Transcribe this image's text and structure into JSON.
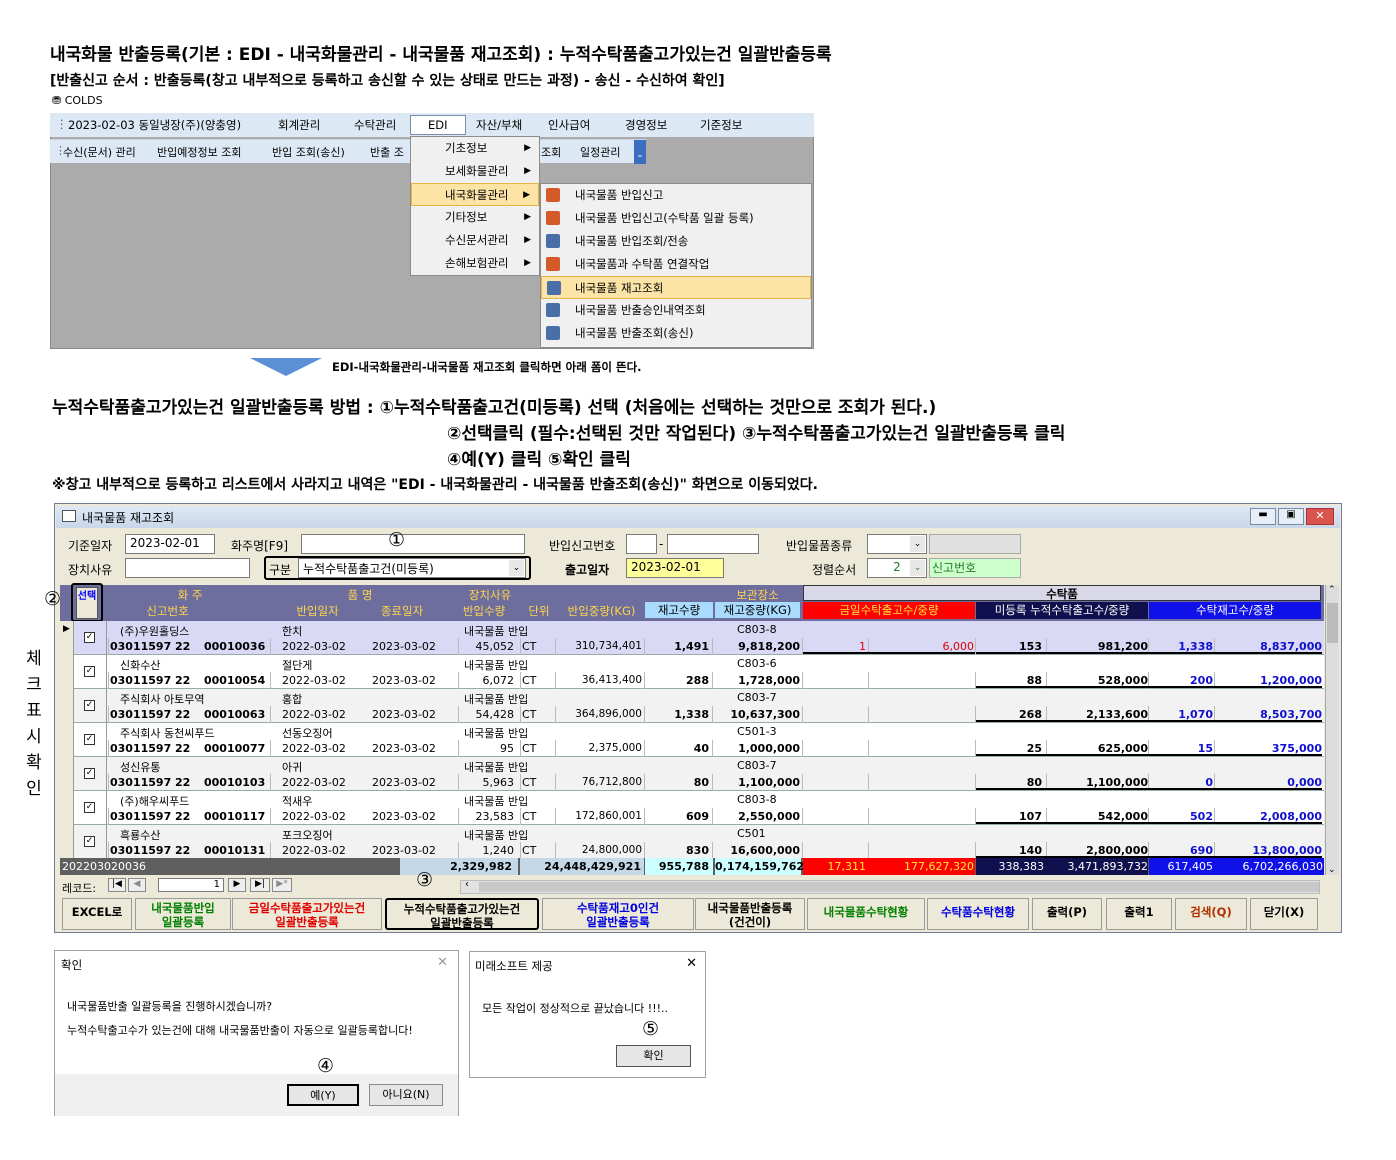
{
  "heading": {
    "title": "내국화물 반출등록(기본 : EDI - 내국화물관리 - 내국물품 재고조회) : 누적수탁품출고가있는건 일괄반출등록",
    "subtitle": "[반출신고 순서 : 반출등록(창고 내부적으로 등록하고 송신할 수 있는 상태로 만드는 과정) - 송신 - 수신하여 확인]",
    "app_name": "COLDS"
  },
  "menubar": {
    "items": [
      "2023-02-03 동일냉장(주)(양충영)",
      "회계관리",
      "수탁관리",
      "EDI",
      "자산/부채",
      "인사급여",
      "경영정보",
      "기준정보"
    ]
  },
  "toolbar": {
    "items": [
      "수신(문서) 관리",
      "반입예정정보 조회",
      "반입 조회(송신)",
      "반출 조",
      "조회",
      "일정관리"
    ]
  },
  "edi_menu": {
    "items": [
      "기초정보",
      "보세화물관리",
      "내국화물관리",
      "기타정보",
      "수신문서관리",
      "손해보험관리"
    ]
  },
  "sub_menu": {
    "items": [
      "내국물품 반입신고",
      "내국물품 반입신고(수탁품 일괄 등록)",
      "내국물품 반입조회/전송",
      "내국물품과 수탁품 연결작업",
      "내국물품 재고조회",
      "내국물품 반출승인내역조회",
      "내국물품 반출조회(송신)"
    ]
  },
  "arrow_note": "EDI-내국화물관리-내국물품 재고조회 클릭하면 아래 폼이 뜬다.",
  "method": {
    "line1": "누적수탁품출고가있는건 일괄반출등록 방법 : ①누적수탁품출고건(미등록) 선택 (처음에는 선택하는 것만으로 조회가 된다.)",
    "line2": "②선택클릭 (필수:선택된 것만 작업된다) ③누적수탁품출고가있는건 일괄반출등록 클릭",
    "line3": "④예(Y) 클릭 ⑤확인 클릭",
    "note": "※창고 내부적으로 등록하고 리스트에서 사라지고 내역은 \"EDI - 내국화물관리 - 내국물품 반출조회(송신)\" 화면으로 이동되었다."
  },
  "side_label": "체크표시확인",
  "window": {
    "title": "내국물품 재고조회"
  },
  "form": {
    "base_date_label": "기준일자",
    "base_date": "2023-02-01",
    "shipper_label": "화주명[F9]",
    "shipper": "",
    "inbound_no_label": "반입신고번호",
    "goods_type_label": "반입물품종류",
    "reason_label": "장치사유",
    "category_label": "구분",
    "category_value": "누적수탁품출고건(미등록)",
    "outbound_date_label": "출고일자",
    "outbound_date": "2023-02-01",
    "sort_label": "정렬순서",
    "sort_value": "2",
    "sort_text": "신고번호"
  },
  "grid_header": {
    "select": "선택",
    "row1": [
      "화 주",
      "품 명",
      "장치사유",
      "보관장소"
    ],
    "row2": [
      "신고번호",
      "반입일자",
      "종료일자",
      "반입수량",
      "단위",
      "반입중량(KG)",
      "재고수량",
      "재고중량(KG)"
    ],
    "consign": "수탁품",
    "consign_cols": [
      "금일수탁출고수/중량",
      "미등록 누적수탁출고수/중량",
      "수탁재고수/중량"
    ]
  },
  "rows": [
    {
      "owner": "(주)우원홀딩스",
      "item": "한치",
      "reason": "내국물품 반입",
      "loc": "C803-8",
      "no1": "03011597",
      "no2": "22",
      "no3": "00010036",
      "in": "2022-03-02",
      "end": "2023-03-02",
      "qty": "45,052",
      "unit": "CT",
      "wt": "310,734,401",
      "sq": "1,491",
      "sw": "9,818,200",
      "tq": "1",
      "tw": "6,000",
      "uq": "153",
      "uw": "981,200",
      "cq": "1,338",
      "cw": "8,837,000"
    },
    {
      "owner": "신화수산",
      "item": "절단게",
      "reason": "내국물품 반입",
      "loc": "C803-6",
      "no1": "03011597",
      "no2": "22",
      "no3": "00010054",
      "in": "2022-03-02",
      "end": "2023-03-02",
      "qty": "6,072",
      "unit": "CT",
      "wt": "36,413,400",
      "sq": "288",
      "sw": "1,728,000",
      "tq": "",
      "tw": "",
      "uq": "88",
      "uw": "528,000",
      "cq": "200",
      "cw": "1,200,000"
    },
    {
      "owner": "주식회사 아토무역",
      "item": "홍합",
      "reason": "내국물품 반입",
      "loc": "C803-7",
      "no1": "03011597",
      "no2": "22",
      "no3": "00010063",
      "in": "2022-03-02",
      "end": "2023-03-02",
      "qty": "54,428",
      "unit": "CT",
      "wt": "364,896,000",
      "sq": "1,338",
      "sw": "10,637,300",
      "tq": "",
      "tw": "",
      "uq": "268",
      "uw": "2,133,600",
      "cq": "1,070",
      "cw": "8,503,700"
    },
    {
      "owner": "주식회사 동천씨푸드",
      "item": "선동오징어",
      "reason": "내국물품 반입",
      "loc": "C501-3",
      "no1": "03011597",
      "no2": "22",
      "no3": "00010077",
      "in": "2022-03-02",
      "end": "2023-03-02",
      "qty": "95",
      "unit": "CT",
      "wt": "2,375,000",
      "sq": "40",
      "sw": "1,000,000",
      "tq": "",
      "tw": "",
      "uq": "25",
      "uw": "625,000",
      "cq": "15",
      "cw": "375,000"
    },
    {
      "owner": "성신유통",
      "item": "아귀",
      "reason": "내국물품 반입",
      "loc": "C803-7",
      "no1": "03011597",
      "no2": "22",
      "no3": "00010103",
      "in": "2022-03-02",
      "end": "2023-03-02",
      "qty": "5,963",
      "unit": "CT",
      "wt": "76,712,800",
      "sq": "80",
      "sw": "1,100,000",
      "tq": "",
      "tw": "",
      "uq": "80",
      "uw": "1,100,000",
      "cq": "0",
      "cw": "0,000"
    },
    {
      "owner": "(주)해우씨푸드",
      "item": "적새우",
      "reason": "내국물품 반입",
      "loc": "C803-8",
      "no1": "03011597",
      "no2": "22",
      "no3": "00010117",
      "in": "2022-03-02",
      "end": "2023-03-02",
      "qty": "23,583",
      "unit": "CT",
      "wt": "172,860,001",
      "sq": "609",
      "sw": "2,550,000",
      "tq": "",
      "tw": "",
      "uq": "107",
      "uw": "542,000",
      "cq": "502",
      "cw": "2,008,000"
    },
    {
      "owner": "흑룡수산",
      "item": "포크오징어",
      "reason": "내국물품 반입",
      "loc": "C501",
      "no1": "03011597",
      "no2": "22",
      "no3": "00010131",
      "in": "2022-03-02",
      "end": "2023-03-02",
      "qty": "1,240",
      "unit": "CT",
      "wt": "24,800,000",
      "sq": "830",
      "sw": "16,600,000",
      "tq": "",
      "tw": "",
      "uq": "140",
      "uw": "2,800,000",
      "cq": "690",
      "cw": "13,800,000"
    }
  ],
  "totals": {
    "code": "202203020036",
    "qty": "2,329,982",
    "wt": "24,448,429,921",
    "sq": "955,788",
    "sw": "0,174,159,762",
    "tq": "17,311",
    "tw": "177,627,320",
    "uq": "338,383",
    "uw": "3,471,893,732",
    "cq": "617,405",
    "cw": "6,702,266,030"
  },
  "nav": {
    "label": "레코드:",
    "value": "1"
  },
  "buttons": [
    "EXCEL로",
    "내국물품반입\n일괄등록",
    "금일수탁품출고가있는건\n일괄반출등록",
    "누적수탁품출고가있는건\n일괄반출등록",
    "수탁품재고0인건\n일괄반출등록",
    "내국물품반출등록\n(건건이)",
    "내국물품수탁현황",
    "수탁품수탁현황",
    "출력(P)",
    "출력1",
    "검색(Q)",
    "닫기(X)"
  ],
  "dialog1": {
    "title": "확인",
    "msg1": "내국물품반출 일괄등록을 진행하시겠습니까?",
    "msg2": "누적수탁출고수가 있는건에 대해 내국물품반출이 자동으로 일괄등록합니다!",
    "yes": "예(Y)",
    "no": "아니요(N)"
  },
  "dialog2": {
    "title": "미래소프트 제공",
    "msg": "모든 작업이 정상적으로 끝났습니다 !!!..",
    "ok": "확인"
  },
  "markers": [
    "①",
    "②",
    "③",
    "④",
    "⑤"
  ]
}
